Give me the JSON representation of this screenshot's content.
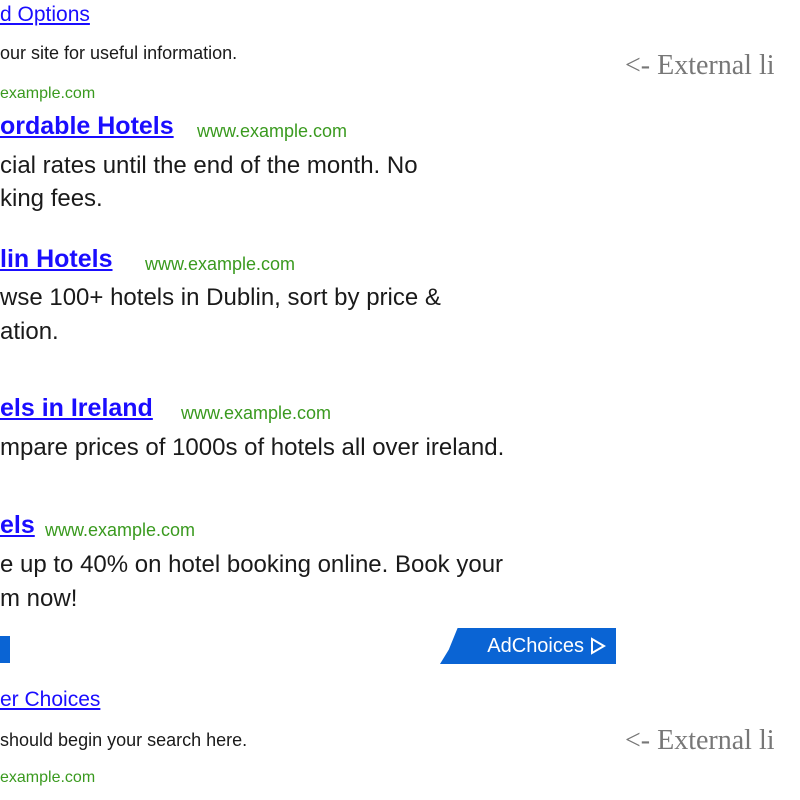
{
  "top_ad": {
    "title": "d Options",
    "desc": "our site for useful information.",
    "url": "example.com"
  },
  "ads": [
    {
      "title": "ordable Hotels",
      "url": "www.example.com",
      "desc": [
        "cial rates until the end of the month. No",
        "king fees."
      ]
    },
    {
      "title": "lin Hotels",
      "url": "www.example.com",
      "desc": [
        "wse 100+ hotels in Dublin, sort by price &",
        "ation."
      ]
    },
    {
      "title": "els in Ireland",
      "url": "www.example.com",
      "desc": [
        "mpare prices of 1000s of hotels all over ireland."
      ]
    },
    {
      "title": "els",
      "url": "www.example.com",
      "desc": [
        "e up to 40% on hotel booking online. Book your",
        "m now!"
      ]
    }
  ],
  "adchoices": {
    "label": "AdChoices",
    "icon": "adchoices-triangle-icon",
    "color": "#0a64d4"
  },
  "bottom_ad": {
    "title": "er Choices",
    "desc": "should begin your search here.",
    "url": "example.com"
  },
  "annotations": [
    "<- External li",
    "<- External li"
  ]
}
